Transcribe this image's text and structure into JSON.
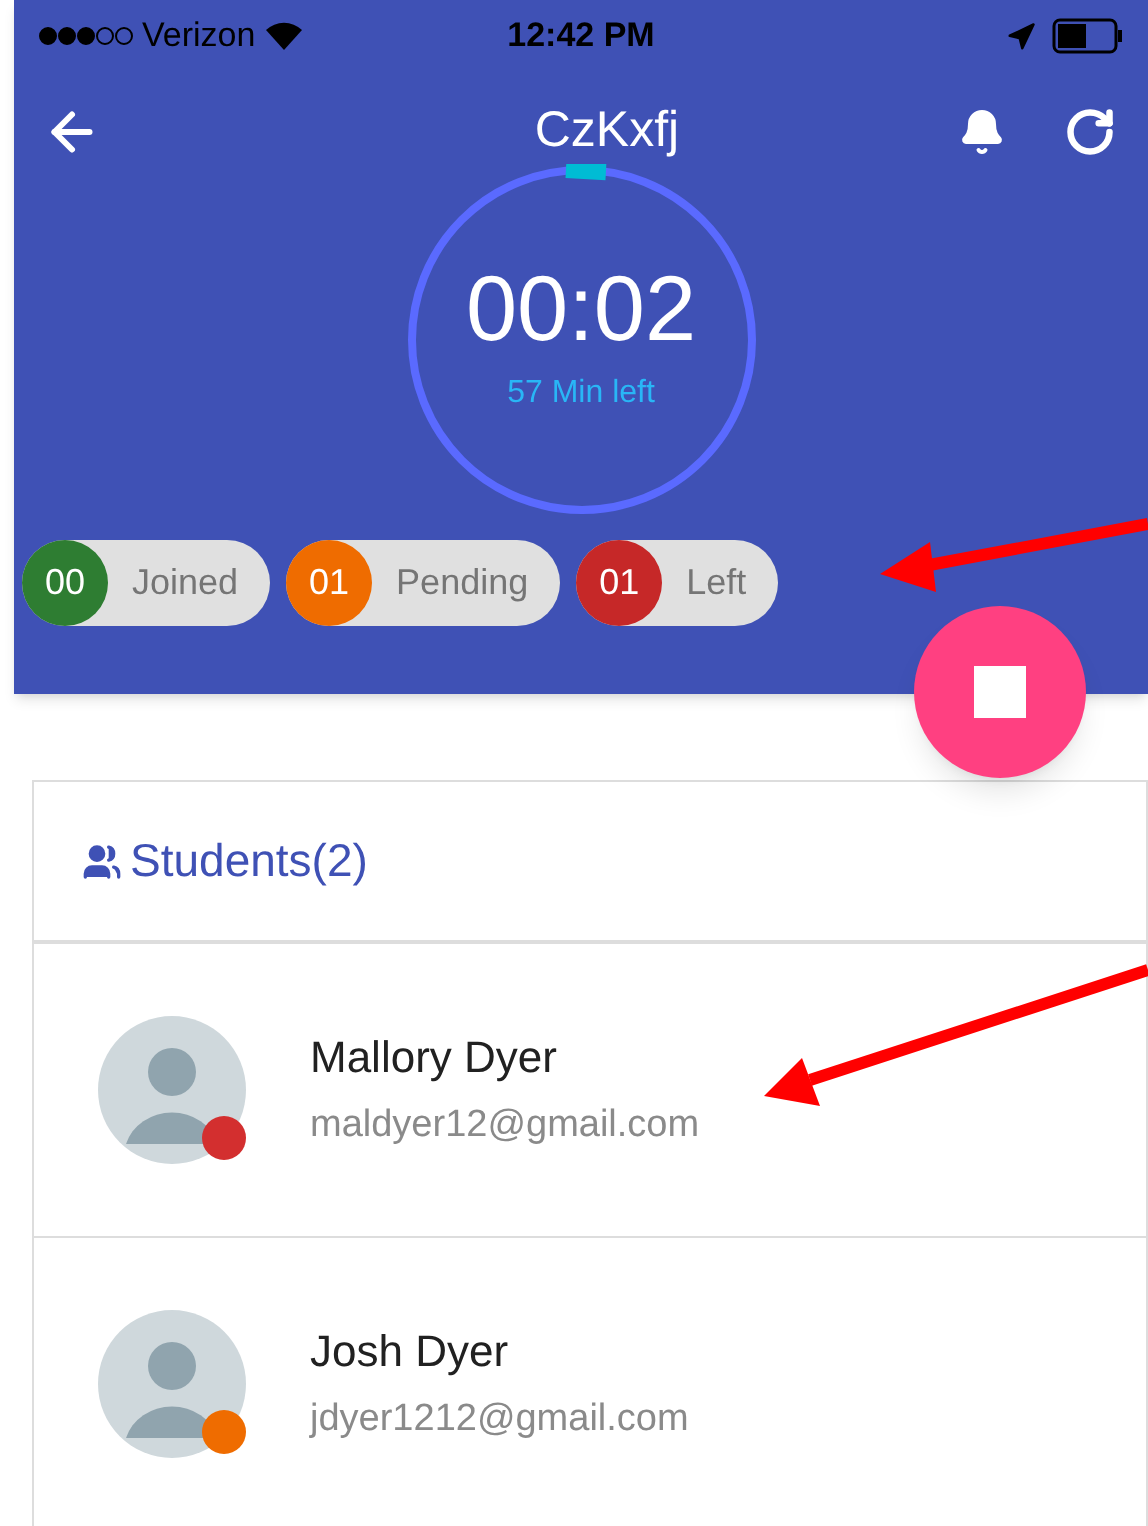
{
  "status_bar": {
    "carrier": "Verizon",
    "time": "12:42 PM"
  },
  "header": {
    "title": "CzKxfj"
  },
  "timer": {
    "time": "00:02",
    "remaining": "57 Min left"
  },
  "counters": [
    {
      "count": "00",
      "label": "Joined",
      "color": "#2e7d32"
    },
    {
      "count": "01",
      "label": "Pending",
      "color": "#ef6c00"
    },
    {
      "count": "01",
      "label": "Left",
      "color": "#c62828"
    }
  ],
  "students": {
    "title": "Students(2)",
    "items": [
      {
        "name": "Mallory Dyer",
        "email": "maldyer12@gmail.com",
        "color": "#d32f2f"
      },
      {
        "name": "Josh Dyer",
        "email": "jdyer1212@gmail.com",
        "color": "#ef6c00"
      }
    ]
  }
}
